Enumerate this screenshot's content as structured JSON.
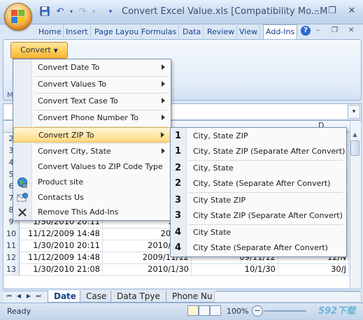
{
  "window": {
    "title": "Convert Excel Value.xls  [Compatibility Mo...M",
    "minimize": "–",
    "restore": "❐",
    "close": "✕"
  },
  "ribbon": {
    "tabs": [
      "Home",
      "Insert",
      "Page Layou",
      "Formulas",
      "Data",
      "Review",
      "View",
      "Add-Ins"
    ],
    "active_tab": "Add-Ins",
    "convert_label": "Convert",
    "group_label": "M",
    "help": "?"
  },
  "menu": {
    "items": [
      {
        "label": "Convert Date To",
        "submenu": true,
        "icon": ""
      },
      {
        "label": "Convert Values To",
        "submenu": true,
        "icon": ""
      },
      {
        "label": "Convert Text Case To",
        "submenu": true,
        "icon": ""
      },
      {
        "label": "Convert Phone Number To",
        "submenu": true,
        "icon": ""
      },
      {
        "label": "Convert ZIP To",
        "submenu": true,
        "icon": "",
        "highlighted": true
      },
      {
        "label": "Convert City, State",
        "submenu": true,
        "icon": ""
      },
      {
        "label": "Convert Values to ZIP Code Type",
        "submenu": false,
        "icon": ""
      },
      {
        "label": "Product site",
        "submenu": false,
        "icon": "globe-icon"
      },
      {
        "label": "Contacts Us",
        "submenu": false,
        "icon": "contacts-icon"
      },
      {
        "label": "Remove This Add-Ins",
        "submenu": false,
        "icon": "remove-x-icon"
      }
    ]
  },
  "submenu": {
    "items": [
      {
        "num": "1",
        "label": "City, State ZIP"
      },
      {
        "num": "1",
        "label": "City, State ZIP (Separate After Convert)"
      },
      {
        "num": "2",
        "label": "City, State"
      },
      {
        "num": "2",
        "label": "City, State (Separate After Convert)"
      },
      {
        "num": "3",
        "label": "City State ZIP"
      },
      {
        "num": "3",
        "label": "City State ZIP (Separate After Convert)"
      },
      {
        "num": "4",
        "label": "City State"
      },
      {
        "num": "4",
        "label": "City State (Separate After Convert)"
      }
    ]
  },
  "grid": {
    "col_d_header": "D",
    "rows": [
      {
        "n": "2",
        "a": "",
        "b": "",
        "c": "",
        "d": ""
      },
      {
        "n": "3",
        "a": "",
        "b": "",
        "c": "",
        "d": ""
      },
      {
        "n": "4",
        "a": "",
        "b": "",
        "c": "",
        "d": ""
      },
      {
        "n": "5",
        "a": "",
        "b": "",
        "c": "",
        "d": ""
      },
      {
        "n": "6",
        "a": "",
        "b": "",
        "c": "",
        "d": ""
      },
      {
        "n": "7",
        "a": "",
        "b": "",
        "c": "",
        "d": ""
      },
      {
        "n": "8",
        "a": "1/30/2010 21:08",
        "b": "2010",
        "c": "",
        "d": ""
      },
      {
        "n": "9",
        "a": "1/30/2010 20:11",
        "b": "2010",
        "c": "",
        "d": ""
      },
      {
        "n": "10",
        "a": "11/12/2009 14:48",
        "b": "2009/1",
        "c": "",
        "d": ""
      },
      {
        "n": "11",
        "a": "1/30/2010 20:11",
        "b": "2010/1/30",
        "c": "10/1/30",
        "d": "30/J"
      },
      {
        "n": "12",
        "a": "11/12/2009 14:48",
        "b": "2009/11/12",
        "c": "09/11/12",
        "d": "12/N"
      },
      {
        "n": "13",
        "a": "1/30/2010 21:08",
        "b": "2010/1/30",
        "c": "10/1/30",
        "d": "30/J"
      }
    ]
  },
  "sheets": {
    "tabs": [
      "Date",
      "Case",
      "Data Tpye",
      "Phone Nu"
    ],
    "active": "Date"
  },
  "status": {
    "text": "Ready",
    "zoom": "100%",
    "zoom_out": "−",
    "watermark": "592下载"
  }
}
